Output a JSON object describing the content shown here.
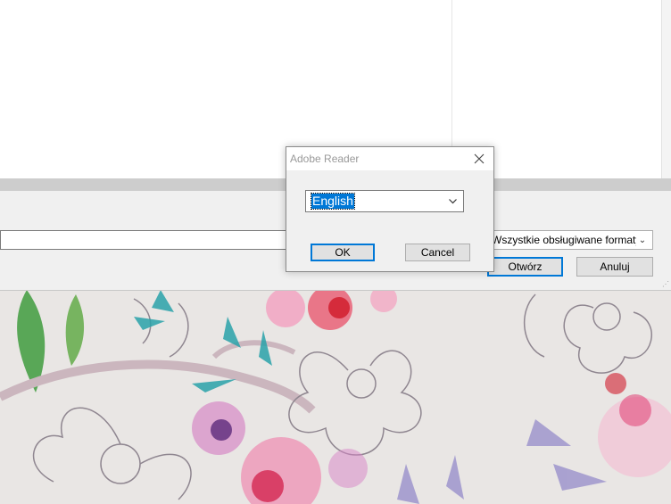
{
  "file_dialog": {
    "filename_value": "",
    "filetype_selected": "Wszystkie obsługiwane formaty",
    "open_label": "Otwórz",
    "cancel_label": "Anuluj"
  },
  "modal": {
    "title": "Adobe Reader",
    "language_selected": "English",
    "ok_label": "OK",
    "cancel_label": "Cancel"
  },
  "colors": {
    "accent": "#0078d7",
    "dialog_bg": "#f0f0f0",
    "wallpaper_bg": "#e9e6e4"
  }
}
